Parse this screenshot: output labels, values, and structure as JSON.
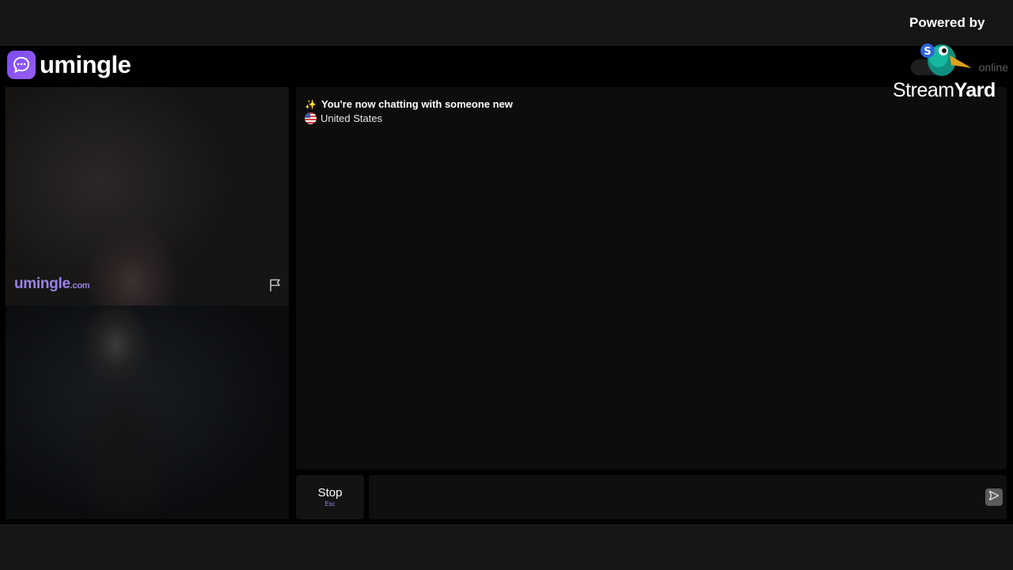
{
  "app": {
    "name": "umingle",
    "online_text": "online"
  },
  "video": {
    "watermark_main": "umingle",
    "watermark_suffix": ".com"
  },
  "chat": {
    "messages": [
      {
        "text": "You're now chatting with someone new",
        "icon": "sparkle-icon"
      },
      {
        "text": "United States",
        "icon": "us-flag-icon"
      }
    ]
  },
  "composer": {
    "stop_label": "Stop",
    "stop_hint": "Esc",
    "input_value": "",
    "input_placeholder": ""
  },
  "overlay": {
    "powered_by": "Powered by",
    "brand_light": "Stream",
    "brand_bold": "Yard"
  },
  "colors": {
    "accent": "#8b5cf6",
    "watermark": "#9a82e6"
  }
}
